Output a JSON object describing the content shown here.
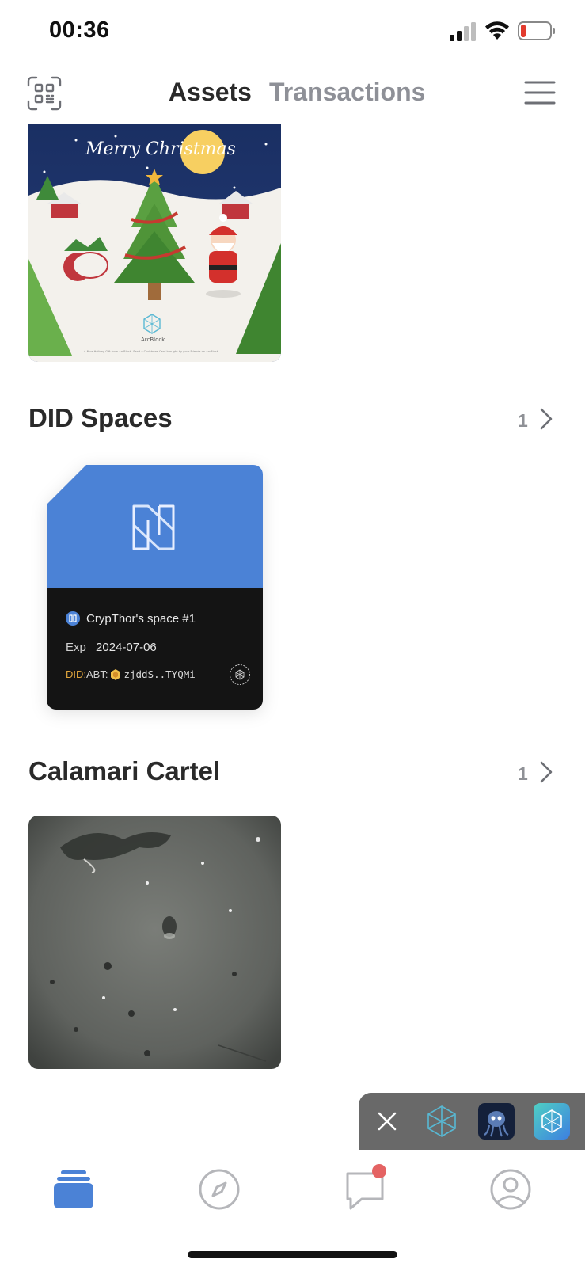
{
  "status_bar": {
    "time": "00:36"
  },
  "header": {
    "tabs": [
      {
        "label": "Assets",
        "active": true
      },
      {
        "label": "Transactions",
        "active": false
      }
    ]
  },
  "nft_christmas": {
    "greeting": "Merry Christmas",
    "brand": "ArcBlock",
    "footer": "A Nice Holiday Gift from ArcBlock. Send a Christmas Card brought by your Friends on ArcBlock"
  },
  "sections": [
    {
      "title": "DID Spaces",
      "count": "1"
    },
    {
      "title": "Calamari Cartel",
      "count": "1"
    }
  ],
  "did_space": {
    "name": "CrypThor's space #1",
    "exp_label": "Exp",
    "exp_date": "2024-07-06",
    "did_prefix": "DID:",
    "did_type": "ABT:",
    "did_short": "zjddS..TYQMi"
  },
  "colors": {
    "accent": "#4b82d6",
    "notification": "#e46363",
    "inactive_tab": "#8e9097",
    "card_dark": "#141414"
  },
  "float_bar": {
    "apps": [
      "arcblock-app",
      "calamari-app",
      "did-wallet-app"
    ]
  },
  "tab_bar": {
    "items": [
      "assets-icon",
      "explore-icon",
      "messages-icon",
      "profile-icon"
    ],
    "active": "assets-icon"
  }
}
